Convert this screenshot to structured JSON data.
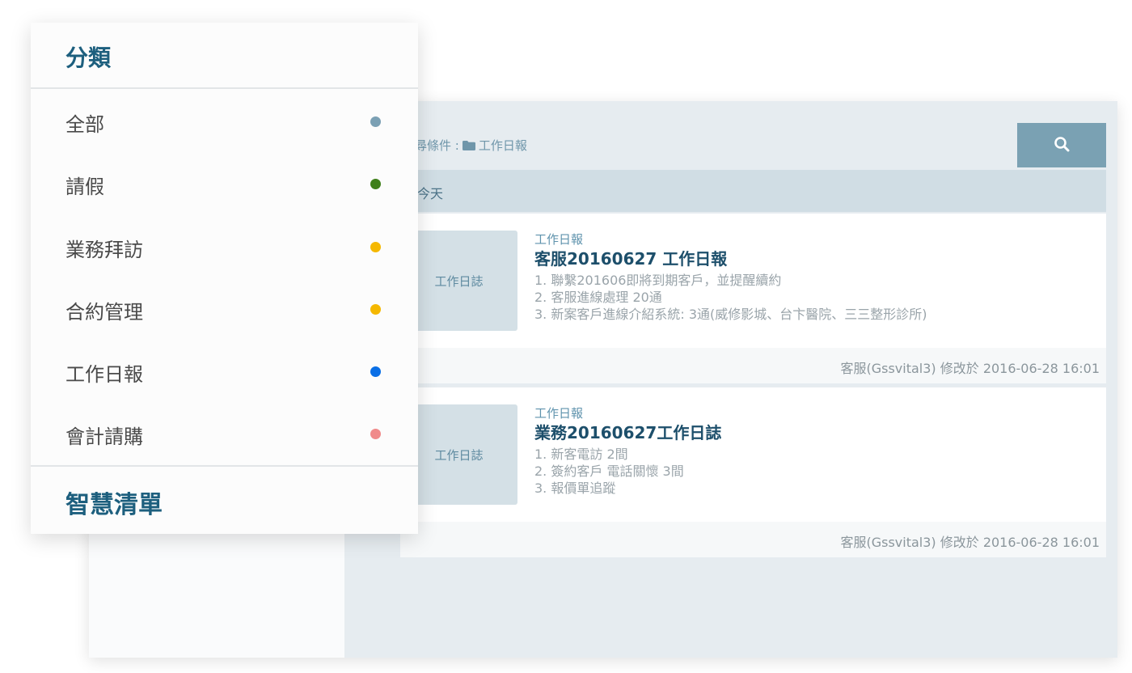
{
  "search": {
    "conditions_label": "搜尋條件 :",
    "folder_name": "工作日報"
  },
  "feed": {
    "date_group": "今天",
    "cards": [
      {
        "thumb_label": "工作日誌",
        "category": "工作日報",
        "title": "客服20160627 工作日報",
        "lines": [
          "1. 聯繫201606即將到期客戶，並提醒續約",
          "2. 客服進線處理 20通",
          "3. 新案客戶進線介紹系統: 3通(威修影城、台卞醫院、三三整形診所)"
        ],
        "footer": "客服(Gssvital3)  修改於  2016-06-28 16:01"
      },
      {
        "thumb_label": "工作日誌",
        "category": "工作日報",
        "title": "業務20160627工作日誌",
        "lines": [
          "1. 新客電訪 2間",
          "2. 簽約客戶 電話關懷 3間",
          "3. 報價單追蹤"
        ],
        "footer": "客服(Gssvital3)  修改於  2016-06-28 16:01"
      }
    ]
  },
  "category_panel": {
    "title": "分類",
    "items": [
      {
        "label": "全部",
        "color": "#7ba0b4"
      },
      {
        "label": "請假",
        "color": "#3f7f1a"
      },
      {
        "label": "業務拜訪",
        "color": "#f5b800"
      },
      {
        "label": "合約管理",
        "color": "#f5b800"
      },
      {
        "label": "工作日報",
        "color": "#0a6fe6"
      },
      {
        "label": "會計請購",
        "color": "#f08a8a"
      }
    ],
    "footer": "智慧清單"
  },
  "icons": {
    "search": "search-icon",
    "folder": "folder-icon"
  }
}
